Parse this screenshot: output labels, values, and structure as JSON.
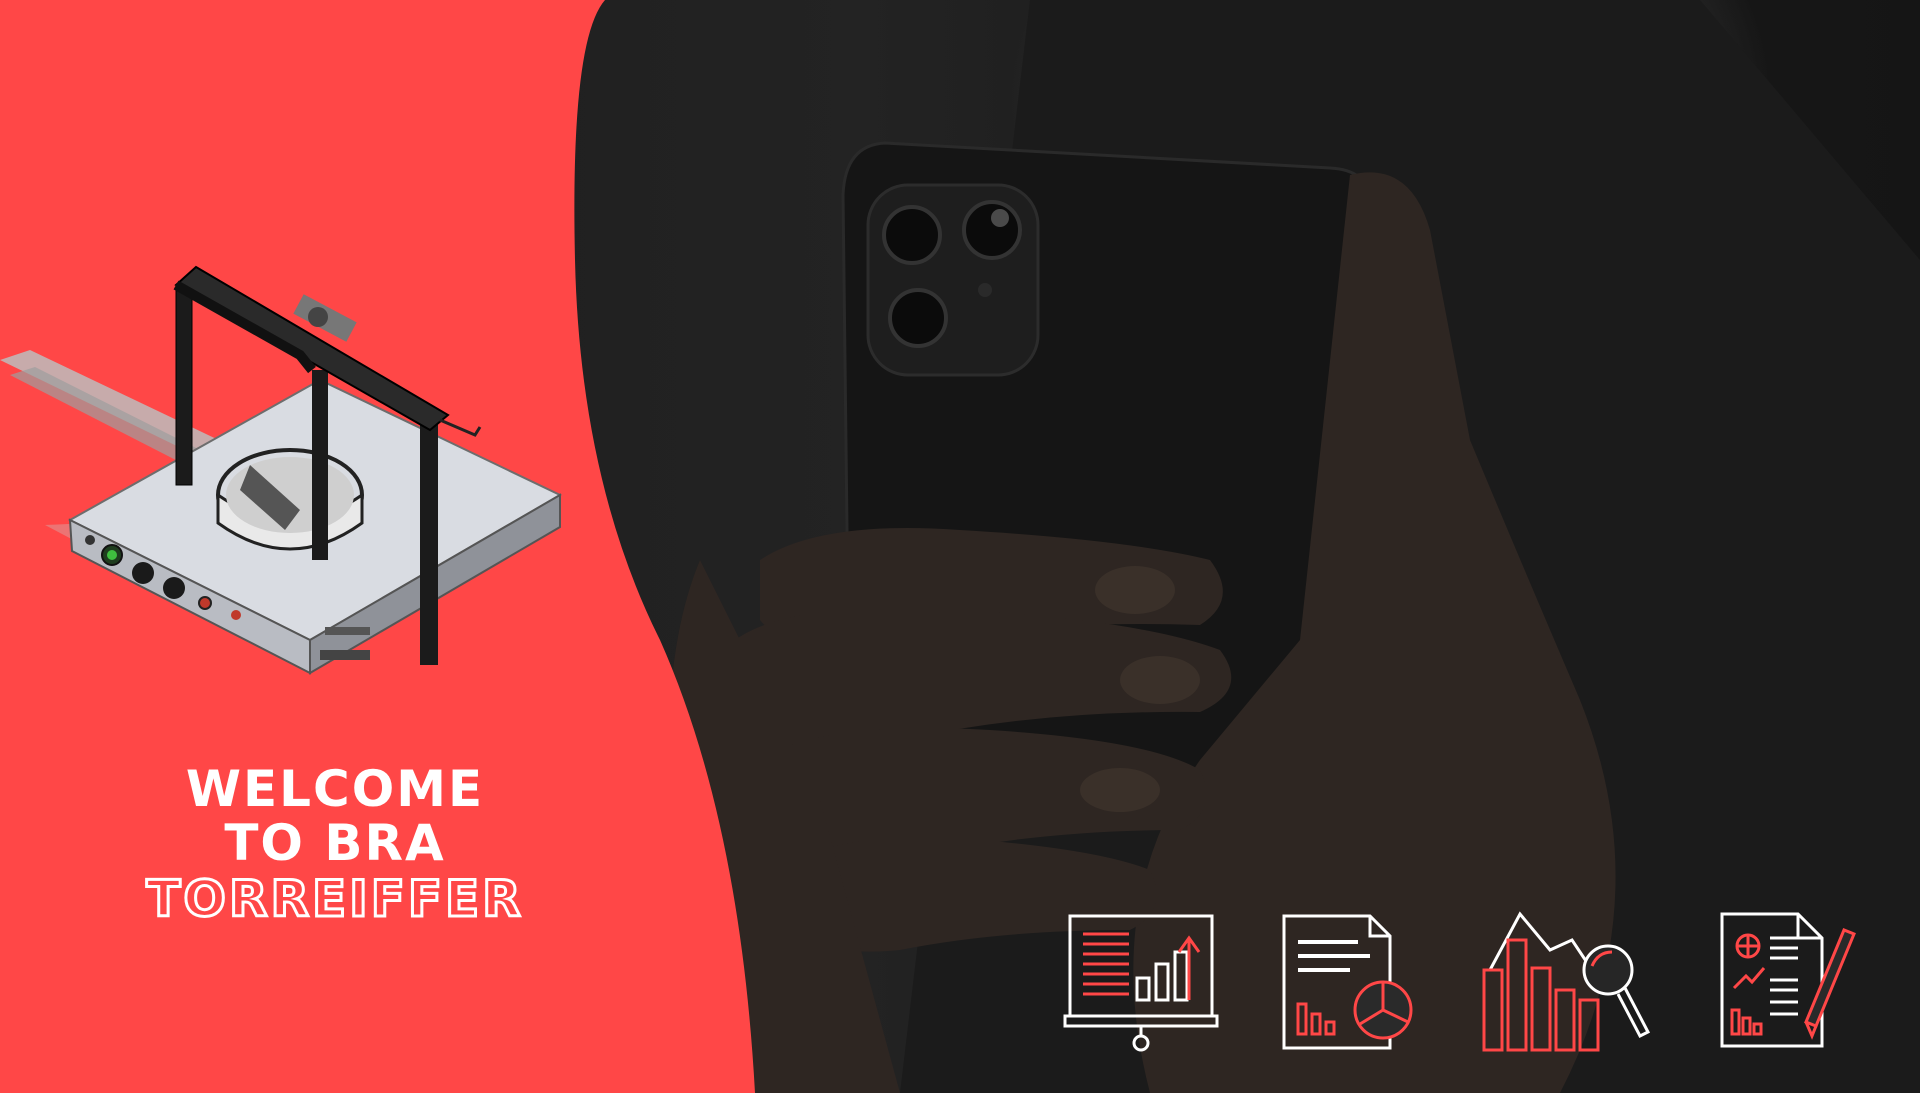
{
  "slide": {
    "welcome_line_1": "WELCOME",
    "welcome_line_2": "TO BRA",
    "brand_name": "TORREIFFER"
  },
  "colors": {
    "accent": "#ff4747",
    "text": "#ffffff",
    "photo_dark": "#1c1c1c"
  },
  "icons": [
    "presentation-growth-icon",
    "report-pie-chart-icon",
    "bar-chart-analysis-icon",
    "document-edit-report-icon"
  ]
}
